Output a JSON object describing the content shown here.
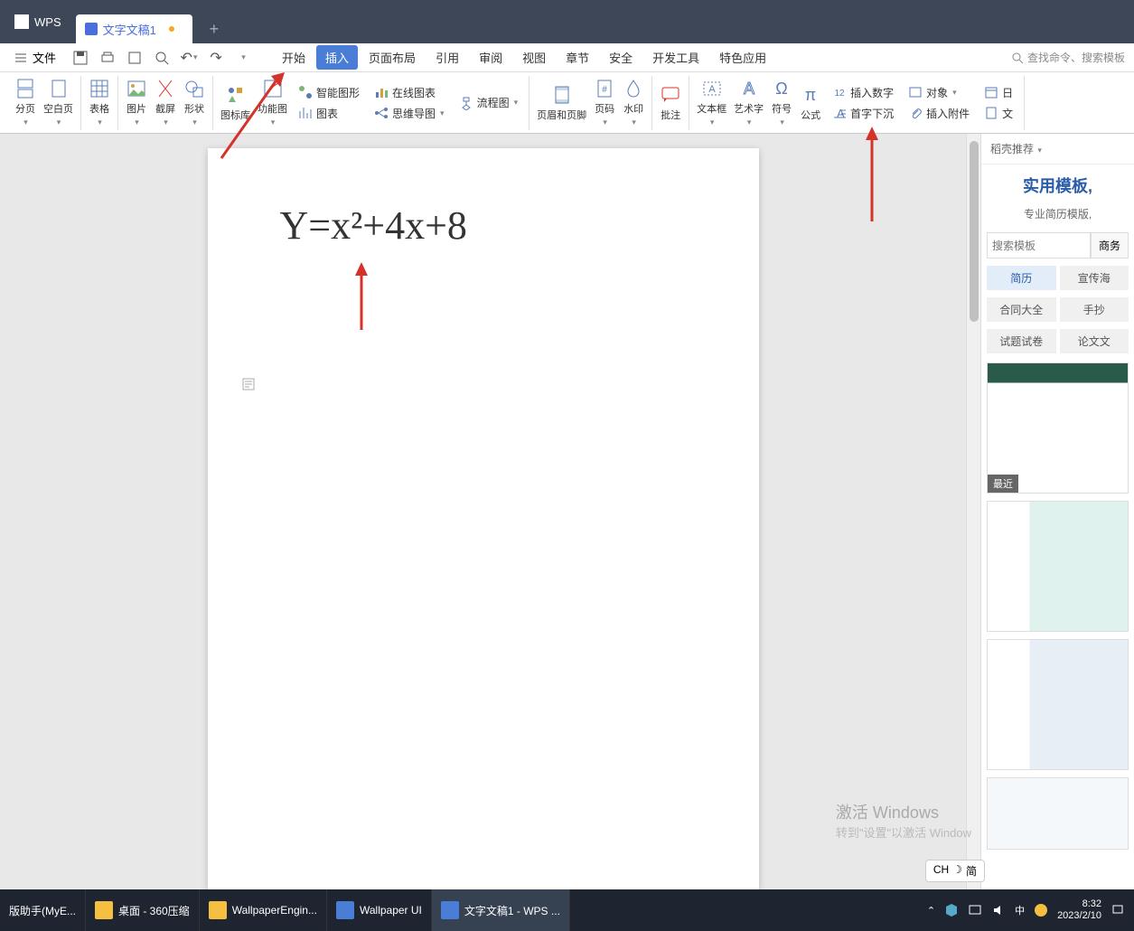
{
  "titlebar": {
    "wps_label": "WPS",
    "doc_tab": "文字文稿1"
  },
  "menubar": {
    "file": "文件",
    "tabs": [
      "开始",
      "插入",
      "页面布局",
      "引用",
      "审阅",
      "视图",
      "章节",
      "安全",
      "开发工具",
      "特色应用"
    ],
    "active_index": 1,
    "search_placeholder": "查找命令、搜索模板"
  },
  "ribbon": {
    "g1": [
      "分页",
      "空白页"
    ],
    "g2": [
      "表格"
    ],
    "g3": [
      "图片",
      "截屏",
      "形状"
    ],
    "g4": [
      "图标库",
      "功能图"
    ],
    "g4_right": [
      "智能图形",
      "在线图表",
      "流程图",
      "图表",
      "思维导图"
    ],
    "g5": [
      "页眉和页脚",
      "页码",
      "水印"
    ],
    "g6": [
      "批注"
    ],
    "g7": [
      "文本框",
      "艺术字",
      "符号",
      "公式"
    ],
    "g7_right": [
      "插入数字",
      "对象",
      "日",
      "首字下沉",
      "插入附件",
      "文"
    ]
  },
  "document": {
    "equation": "Y=x²+4x+8"
  },
  "sidebar": {
    "header": "稻壳推荐",
    "title": "实用模板,",
    "subtitle": "专业简历模版,",
    "search_placeholder": "搜索模板",
    "search_btn": "商务",
    "row1": [
      "简历",
      "宣传海"
    ],
    "row2": [
      "合同大全",
      "手抄"
    ],
    "row3": [
      "试题试卷",
      "论文文"
    ],
    "badge": "最近"
  },
  "watermark": {
    "title": "激活 Windows",
    "sub": "转到\"设置\"以激活 Window"
  },
  "ime": {
    "lang": "CH",
    "mode": "简"
  },
  "taskbar": {
    "items": [
      "版助手(MyE...",
      "桌面 - 360压缩",
      "WallpaperEngin...",
      "Wallpaper UI",
      "文字文稿1 - WPS ..."
    ],
    "active_index": 4,
    "time": "8:32",
    "date": "2023/2/10",
    "ime": "中"
  }
}
